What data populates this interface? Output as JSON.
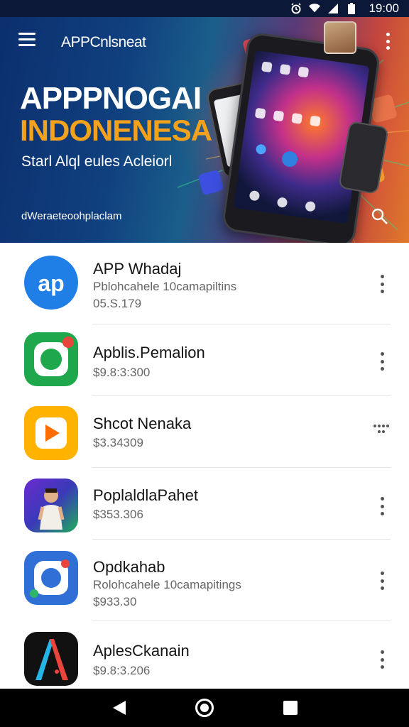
{
  "status_bar": {
    "time": "19:00",
    "icons": [
      "alarm-icon",
      "wifi-icon",
      "signal-icon",
      "battery-icon"
    ]
  },
  "header": {
    "app_name": "APPCnlsneat",
    "menu_icon": "hamburger-menu-icon",
    "overflow_icon": "more-vert-icon",
    "search_icon": "search-icon"
  },
  "hero": {
    "title_line1": "APPPNOGAI",
    "title_line2": "INDONENESA",
    "tagline": "Starl Alql eules Acleiorl",
    "url": "dWeraeteoohplaclam",
    "colors": {
      "title1": "#ffffff",
      "title2": "#f4a11c"
    }
  },
  "apps": [
    {
      "name": "APP Whadaj",
      "subtitle": "Pblohcahele 10camapiltins",
      "price": "05.S.179",
      "icon": "app-blue-ap-icon",
      "icon_color": "#1f7fe6",
      "menu": "more-vert-icon"
    },
    {
      "name": "Apblis.Pemalion",
      "subtitle": "",
      "price": "$9.8:3:300",
      "icon": "app-green-ring-icon",
      "icon_color": "#1ea84b",
      "menu": "more-vert-icon"
    },
    {
      "name": "Shcot Nenaka",
      "subtitle": "",
      "price": "$3.34309",
      "icon": "app-yellow-play-icon",
      "icon_color": "#ffb300",
      "menu": "more-horiz-icon"
    },
    {
      "name": "PoplaldlaPahet",
      "subtitle": "",
      "price": "$353.306",
      "icon": "app-purple-person-icon",
      "icon_color": "#5b2bb0",
      "menu": "more-vert-icon"
    },
    {
      "name": "Opdkahab",
      "subtitle": "Rolohcahele 10camapitings",
      "price": "$933.30",
      "icon": "app-blue-ring-icon",
      "icon_color": "#2f6fd6",
      "menu": "more-vert-icon"
    },
    {
      "name": "AplesCkanain",
      "subtitle": "",
      "price": "$9.8:3.206",
      "icon": "app-black-a-icon",
      "icon_color": "#111111",
      "menu": "more-vert-icon"
    }
  ],
  "nav_bar": {
    "back": "back-triangle-icon",
    "home": "home-circle-icon",
    "recent": "recents-square-icon"
  }
}
